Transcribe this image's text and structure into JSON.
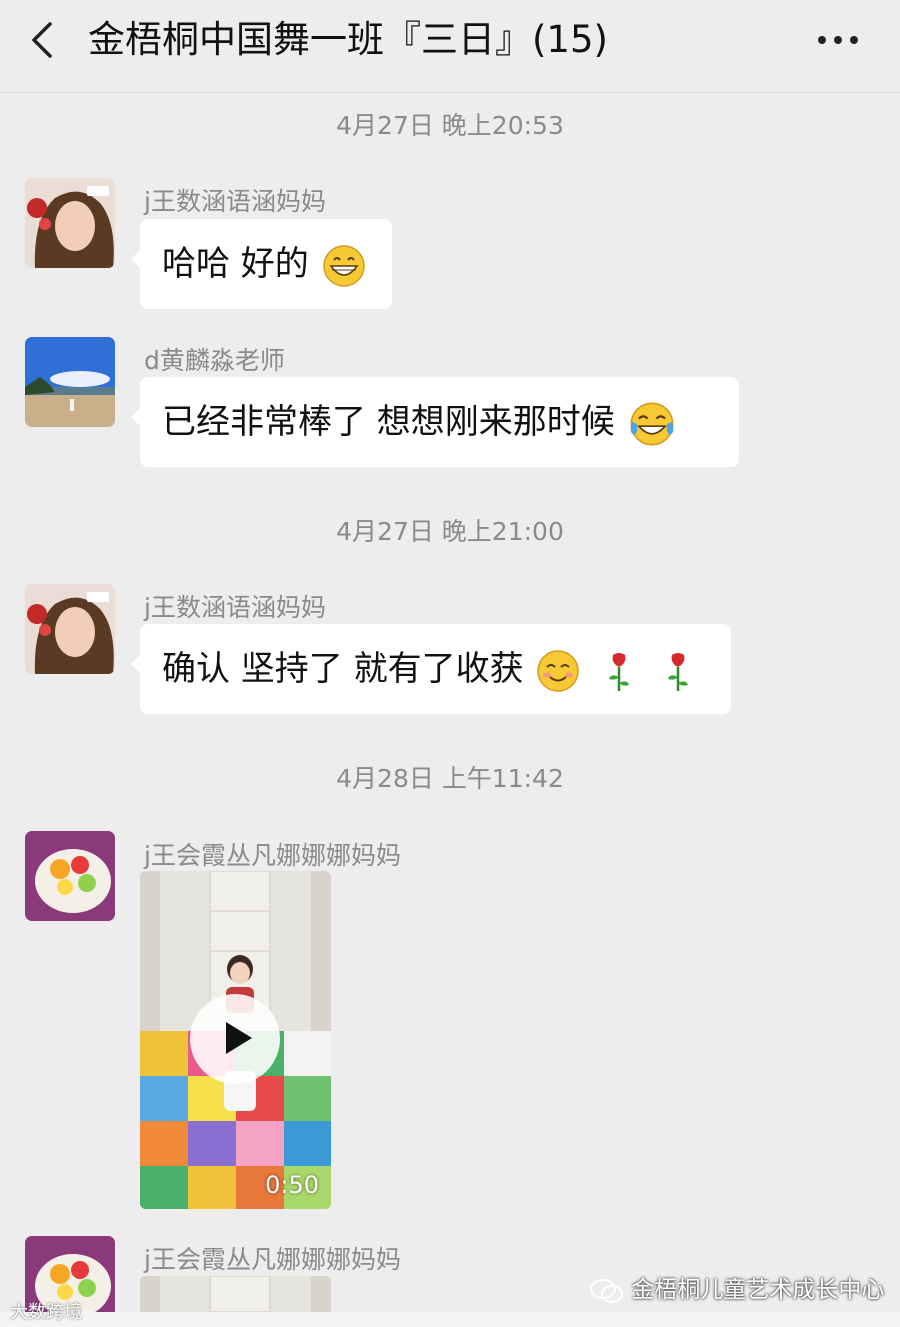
{
  "header": {
    "title": "金梧桐中国舞一班『三日』(15)"
  },
  "messages": [
    {
      "kind": "time",
      "text": "4月27日 晚上20:53"
    },
    {
      "kind": "msg",
      "sender": "j王数涵语涵妈妈",
      "text": "哈哈 好的",
      "emoji": "grinning-face-icon"
    },
    {
      "kind": "msg",
      "sender": "d黄麟淼老师",
      "text": "已经非常棒了 想想刚来那时候",
      "emoji": "tears-of-joy-icon"
    },
    {
      "kind": "time",
      "text": "4月27日 晚上21:00"
    },
    {
      "kind": "msg",
      "sender": "j王数涵语涵妈妈",
      "text": "确认 坚持了 就有了收获",
      "emoji": "smiling-face-icon, rose-icon, rose-icon"
    },
    {
      "kind": "time",
      "text": "4月28日 上午11:42"
    },
    {
      "kind": "video",
      "sender": "j王会霞丛凡娜娜娜妈妈",
      "duration": "0:50"
    },
    {
      "kind": "video",
      "sender": "j王会霞丛凡娜娜娜妈妈"
    }
  ],
  "watermark": {
    "right": "金梧桐儿童艺术成长中心",
    "left": "大数跨境"
  }
}
